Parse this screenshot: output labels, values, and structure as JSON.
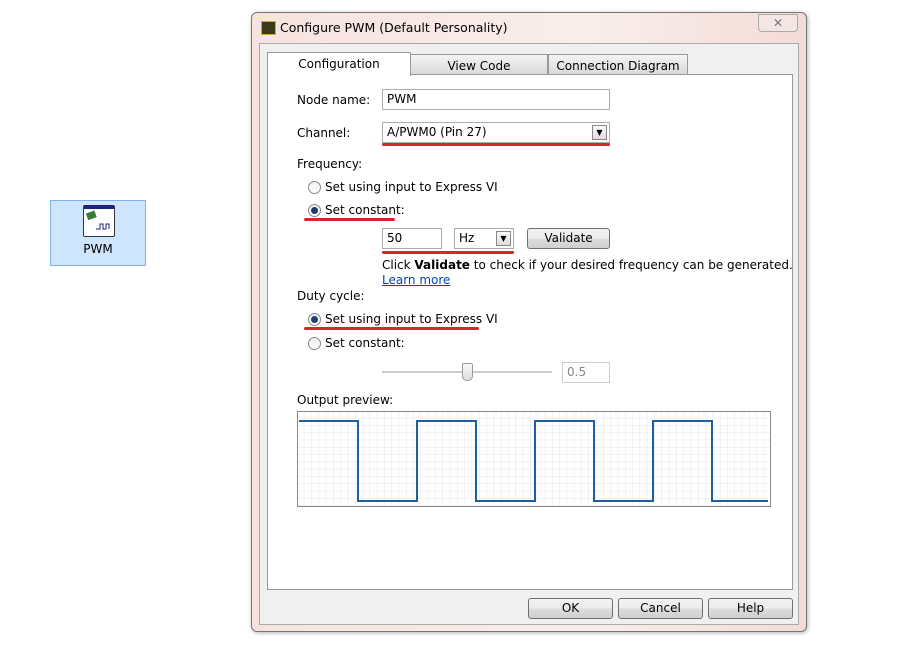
{
  "node": {
    "label": "PWM",
    "icon": "pwm-express-vi-icon"
  },
  "dialog": {
    "title": "Configure PWM (Default Personality)",
    "close_icon": "close-icon",
    "tabs": [
      {
        "label": "Configuration",
        "active": true
      },
      {
        "label": "View Code",
        "active": false
      },
      {
        "label": "Connection Diagram",
        "active": false
      }
    ],
    "node_name": {
      "label": "Node name:",
      "value": "PWM"
    },
    "channel": {
      "label": "Channel:",
      "value": "A/PWM0 (Pin 27)"
    },
    "frequency": {
      "label": "Frequency:",
      "option_input": "Set using input to Express VI",
      "option_constant": "Set constant:",
      "selected": "constant",
      "value": "50",
      "unit": "Hz",
      "validate_label": "Validate",
      "hint_pre": "Click ",
      "hint_bold": "Validate",
      "hint_post": " to check if your desired frequency can be generated.",
      "learn_more": "Learn more"
    },
    "duty_cycle": {
      "label": "Duty cycle:",
      "option_input": "Set using input to Express VI",
      "option_constant": "Set constant:",
      "selected": "input",
      "value": "0.5",
      "slider_fraction": 0.5
    },
    "output_preview": {
      "label": "Output preview:",
      "duty": 0.5,
      "periods": 4,
      "line_color": "#1f5fa0"
    },
    "buttons": {
      "ok": "OK",
      "cancel": "Cancel",
      "help": "Help"
    },
    "highlight_color": "#d9232e"
  }
}
